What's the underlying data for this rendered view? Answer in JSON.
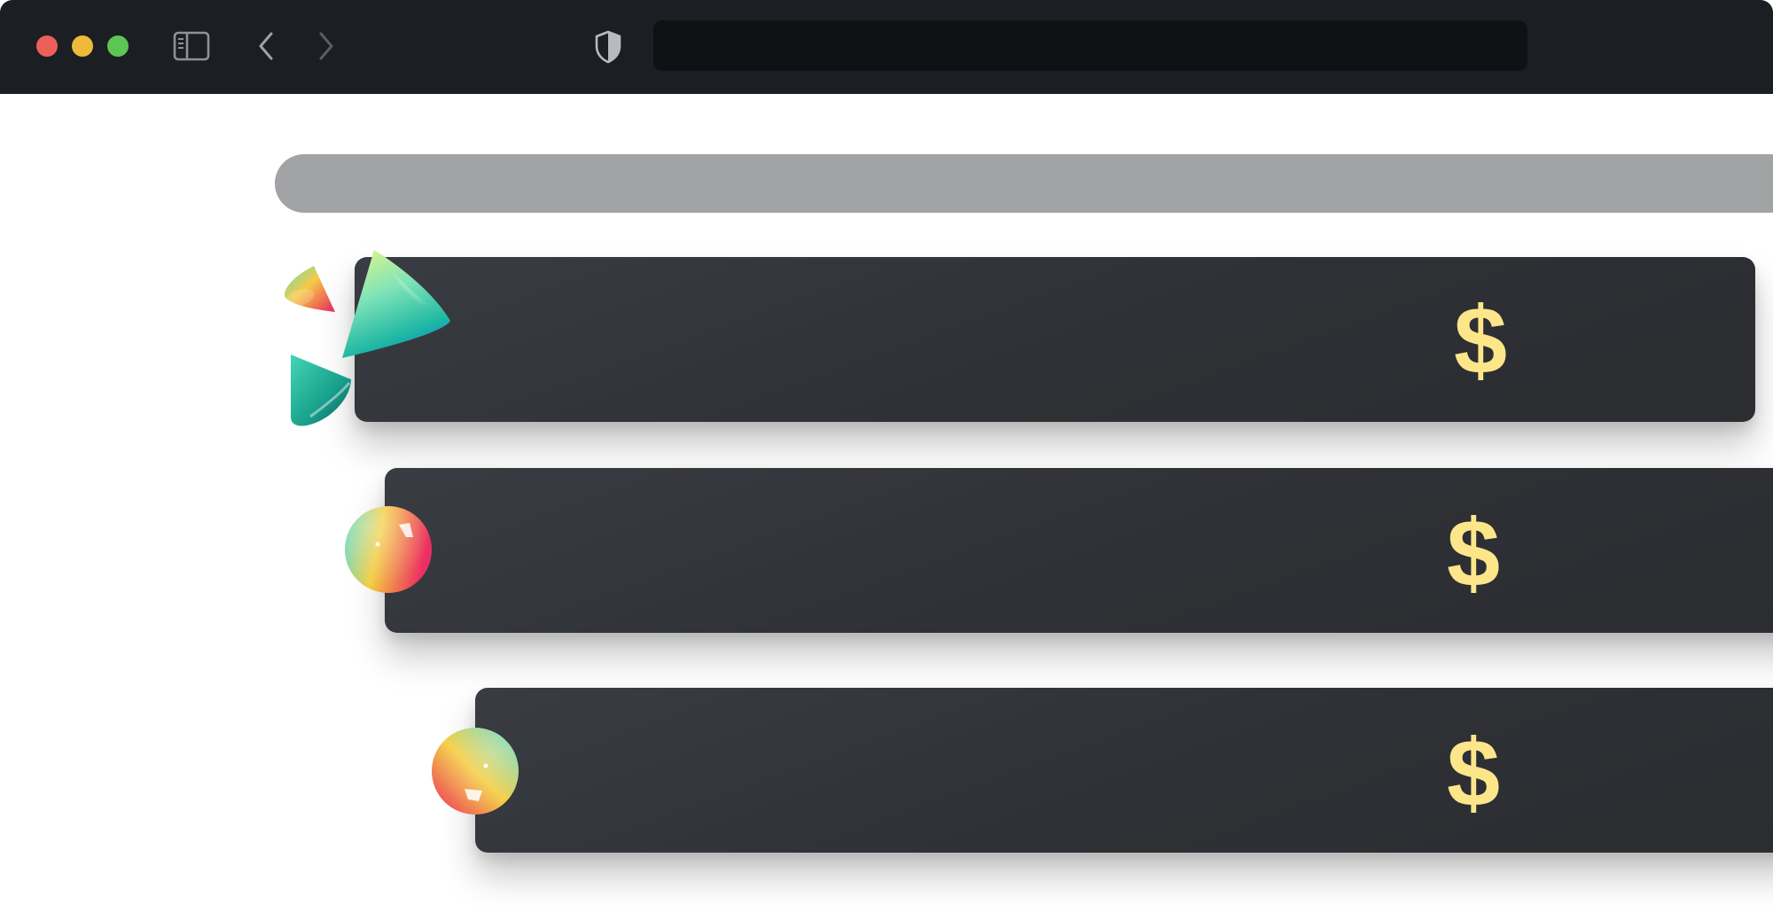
{
  "window": {
    "traffic_lights": {
      "close_color": "#ec5f5a",
      "minimize_color": "#f0b93a",
      "maximize_color": "#5dc552"
    },
    "toolbar": {
      "sidebar_icon": "sidebar-icon",
      "back_icon": "chevron-left-icon",
      "forward_icon": "chevron-right-icon",
      "privacy_icon": "shield-icon"
    },
    "address_bar": {
      "value": ""
    }
  },
  "main": {
    "search_bar": {
      "value": ""
    },
    "plans": [
      {
        "price_symbol": "$",
        "decoration": "cones-icon"
      },
      {
        "price_symbol": "$",
        "decoration": "sphere-icon"
      },
      {
        "price_symbol": "$",
        "decoration": "sphere-icon"
      }
    ]
  },
  "colors": {
    "accent": "#fde68a",
    "card_background": "#2e3035",
    "chrome_background": "#1b1e22",
    "address_bar_background": "#0f1114",
    "search_bar_background": "#a2a3a5"
  }
}
